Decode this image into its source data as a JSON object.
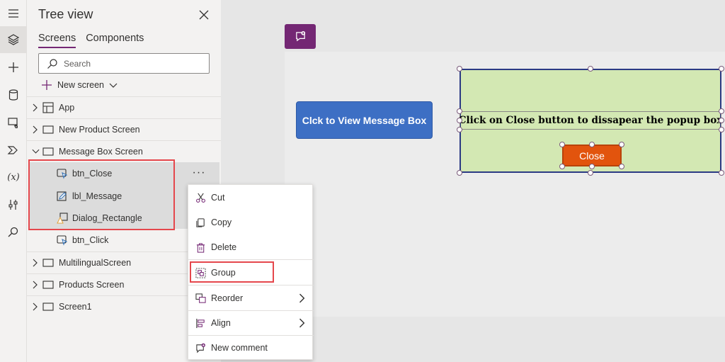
{
  "colors": {
    "accent": "#742774",
    "highlight": "#e5474c",
    "blue_button": "#3d6fc4",
    "dialog_fill": "#d3e8b3",
    "close_button": "#e2540d"
  },
  "rail": {
    "icons": [
      "hamburger-icon",
      "layers-icon",
      "plus-icon",
      "database-icon",
      "media-icon",
      "power-automate-icon",
      "variables-icon",
      "tools-icon",
      "search-icon"
    ],
    "variables_label": "(x)"
  },
  "tree": {
    "title": "Tree view",
    "tabs": [
      "Screens",
      "Components"
    ],
    "search_placeholder": "Search",
    "new_screen_label": "New screen",
    "items": [
      {
        "label": "App",
        "icon": "app-icon"
      },
      {
        "label": "New Product Screen",
        "icon": "screen-icon"
      },
      {
        "label": "Message Box Screen",
        "icon": "screen-icon"
      },
      {
        "label": "btn_Close",
        "icon": "button-icon"
      },
      {
        "label": "lbl_Message",
        "icon": "label-icon"
      },
      {
        "label": "Dialog_Rectangle",
        "icon": "shape-icon"
      },
      {
        "label": "btn_Click",
        "icon": "button-icon"
      },
      {
        "label": "MultilingualScreen",
        "icon": "screen-icon"
      },
      {
        "label": "Products Screen",
        "icon": "screen-icon"
      },
      {
        "label": "Screen1",
        "icon": "screen-icon"
      }
    ],
    "more_label": "···"
  },
  "context_menu": {
    "items": [
      {
        "label": "Cut",
        "icon": "scissors-icon"
      },
      {
        "label": "Copy",
        "icon": "copy-icon"
      },
      {
        "label": "Delete",
        "icon": "trash-icon"
      },
      {
        "label": "Group",
        "icon": "group-icon"
      },
      {
        "label": "Reorder",
        "icon": "reorder-icon"
      },
      {
        "label": "Align",
        "icon": "align-icon"
      },
      {
        "label": "New comment",
        "icon": "comment-icon"
      }
    ]
  },
  "canvas": {
    "view_button_label": "Clck to View Message Box",
    "dialog_message": "Click on Close button to dissapear the popup box",
    "close_button_label": "Close"
  }
}
